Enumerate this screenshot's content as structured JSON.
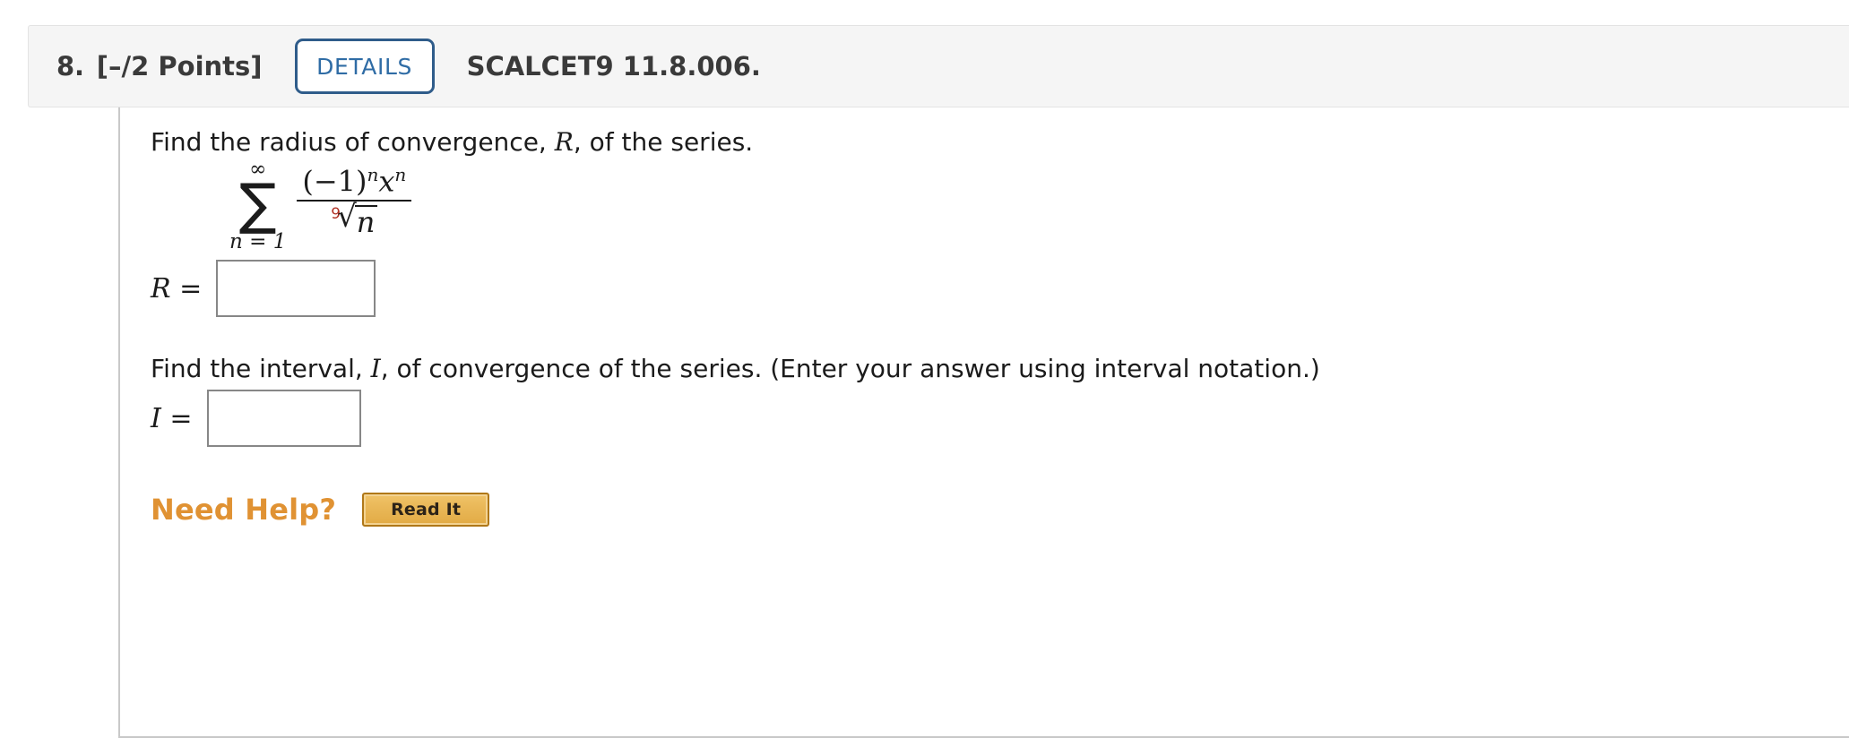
{
  "header": {
    "question_number": "8.",
    "points": "[–/2 Points]",
    "details_button_label": "DETAILS",
    "textbook_code": "SCALCET9 11.8.006.",
    "background_color": "#f5f5f5",
    "details_border_color": "#2f5c8a",
    "details_text_color": "#2f6ca5"
  },
  "content": {
    "prompt_radius": {
      "part1": "Find the radius of convergence, ",
      "variable": "R",
      "part2": ", of the series."
    },
    "prompt_interval": {
      "part1": "Find the interval, ",
      "variable": "I",
      "part2": ", of convergence of the series. (Enter your answer using interval notation.)"
    },
    "formula": {
      "sigma_symbol": "∑",
      "upper_limit": "∞",
      "lower_limit": "n = 1",
      "numerator": {
        "base": "(−1)",
        "base_exponent": "n",
        "variable": "x",
        "variable_exponent": "n"
      },
      "denominator": {
        "radical_index": "9",
        "radical_sign": "√",
        "radicand": "n",
        "index_color": "#b03124"
      }
    },
    "answers": [
      {
        "label": "R =",
        "value": "",
        "placeholder": ""
      },
      {
        "label": "I =",
        "value": "",
        "placeholder": ""
      }
    ],
    "need_help": {
      "label": "Need Help?",
      "label_color": "#e09233",
      "button_label": "Read It",
      "button_fill_color": "#e9b757",
      "button_border_color": "#b07818"
    }
  }
}
